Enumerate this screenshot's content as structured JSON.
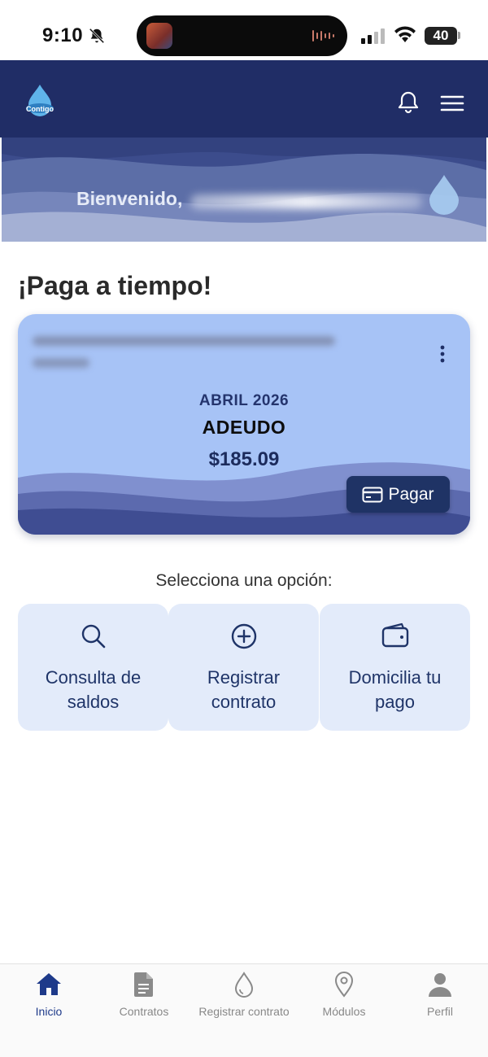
{
  "status_bar": {
    "time": "9:10",
    "battery": "40",
    "icons": [
      "bell-slash-icon",
      "app-thumbnail-icon",
      "audio-wave-icon",
      "signal-icon",
      "wifi-icon",
      "battery-icon"
    ]
  },
  "header": {
    "logo_text": "Contigo",
    "icons": [
      "logo-drop-icon",
      "bell-icon",
      "menu-icon"
    ],
    "color": "#202d66"
  },
  "banner": {
    "greeting": "Bienvenido,",
    "icon": "water-drop-icon"
  },
  "main": {
    "section_title": "¡Paga a tiempo!",
    "card": {
      "month": "ABRIL 2026",
      "status": "ADEUDO",
      "amount": "$185.09",
      "pay_label": "Pagar",
      "icons": [
        "kebab-menu-icon",
        "credit-card-icon"
      ],
      "background": "#a7c3f6"
    },
    "options_label": "Selecciona una opción:",
    "options": [
      {
        "line1": "Consulta de",
        "line2": "saldos",
        "icon": "search-icon"
      },
      {
        "line1": "Registrar",
        "line2": "contrato",
        "icon": "plus-circle-icon"
      },
      {
        "line1": "Domicilia tu",
        "line2": "pago",
        "icon": "wallet-icon"
      }
    ]
  },
  "bottom_nav": {
    "items": [
      {
        "label": "Inicio",
        "icon": "home-icon",
        "active": true
      },
      {
        "label": "Contratos",
        "icon": "document-icon",
        "active": false
      },
      {
        "label": "Registrar contrato",
        "icon": "water-drop-icon",
        "active": false
      },
      {
        "label": "Módulos",
        "icon": "map-pin-icon",
        "active": false
      },
      {
        "label": "Perfil",
        "icon": "user-icon",
        "active": false
      }
    ],
    "active_color": "#1e3a8a",
    "inactive_color": "#888888"
  }
}
